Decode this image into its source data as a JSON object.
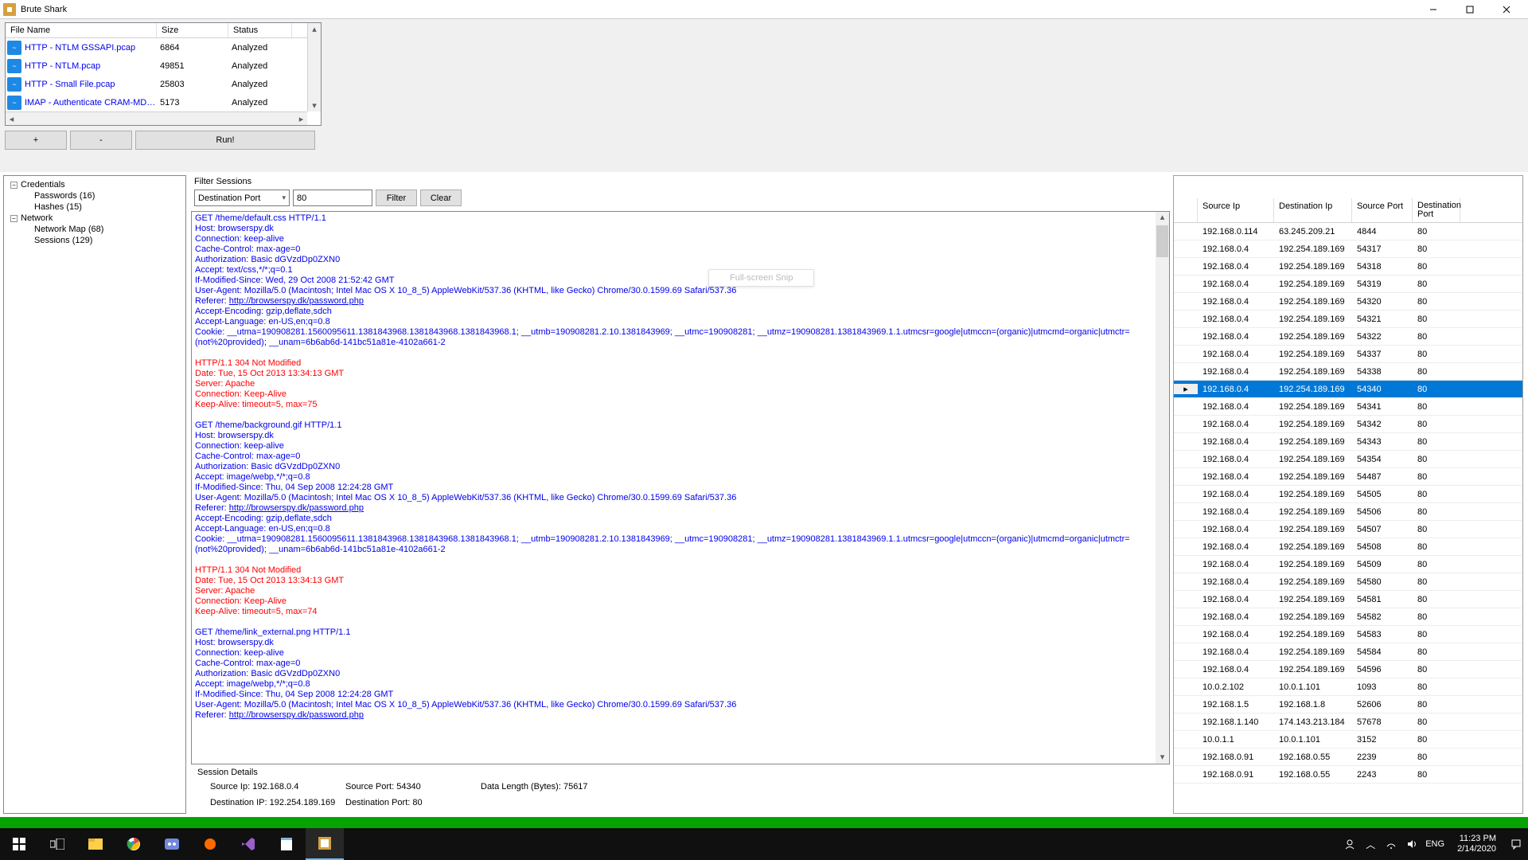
{
  "window": {
    "title": "Brute Shark"
  },
  "file_table": {
    "headers": {
      "name": "File Name",
      "size": "Size",
      "status": "Status"
    },
    "rows": [
      {
        "name": "HTTP - NTLM GSSAPI.pcap",
        "size": "6864",
        "status": "Analyzed"
      },
      {
        "name": "HTTP - NTLM.pcap",
        "size": "49851",
        "status": "Analyzed"
      },
      {
        "name": "HTTP - Small File.pcap",
        "size": "25803",
        "status": "Analyzed"
      },
      {
        "name": "IMAP - Authenticate CRAM-MD5...",
        "size": "5173",
        "status": "Analyzed"
      }
    ]
  },
  "buttons": {
    "plus": "+",
    "minus": "-",
    "run": "Run!"
  },
  "tree": {
    "credentials": "Credentials",
    "passwords": "Passwords (16)",
    "hashes": "Hashes (15)",
    "network": "Network",
    "map": "Network Map (68)",
    "sessions": "Sessions (129)"
  },
  "filter": {
    "label": "Filter Sessions",
    "field": "Destination Port",
    "value": "80",
    "filter_btn": "Filter",
    "clear_btn": "Clear"
  },
  "http": {
    "req1": [
      "GET /theme/default.css HTTP/1.1",
      "Host: browserspy.dk",
      "Connection: keep-alive",
      "Cache-Control: max-age=0",
      "Authorization: Basic dGVzdDp0ZXN0",
      "Accept: text/css,*/*;q=0.1",
      "If-Modified-Since: Wed, 29 Oct 2008 21:52:42 GMT",
      "User-Agent: Mozilla/5.0 (Macintosh; Intel Mac OS X 10_8_5) AppleWebKit/537.36 (KHTML, like Gecko) Chrome/30.0.1599.69 Safari/537.36",
      "Accept-Encoding: gzip,deflate,sdch",
      "Accept-Language: en-US,en;q=0.8",
      "Cookie: __utma=190908281.1560095611.1381843968.1381843968.1381843968.1; __utmb=190908281.2.10.1381843969; __utmc=190908281; __utmz=190908281.1381843969.1.1.utmcsr=google|utmccn=(organic)|utmcmd=organic|utmctr=(not%20provided); __unam=6b6ab6d-141bc51a81e-4102a661-2"
    ],
    "referer_label": "Referer: ",
    "referer_url": "http://browserspy.dk/password.php",
    "resp1": [
      "HTTP/1.1 304 Not Modified",
      "Date: Tue, 15 Oct 2013 13:34:13 GMT",
      "Server: Apache",
      "Connection: Keep-Alive",
      "Keep-Alive: timeout=5, max=75"
    ],
    "req2": [
      "GET /theme/background.gif HTTP/1.1",
      "Host: browserspy.dk",
      "Connection: keep-alive",
      "Cache-Control: max-age=0",
      "Authorization: Basic dGVzdDp0ZXN0",
      "Accept: image/webp,*/*;q=0.8",
      "If-Modified-Since: Thu, 04 Sep 2008 12:24:28 GMT",
      "User-Agent: Mozilla/5.0 (Macintosh; Intel Mac OS X 10_8_5) AppleWebKit/537.36 (KHTML, like Gecko) Chrome/30.0.1599.69 Safari/537.36",
      "Accept-Encoding: gzip,deflate,sdch",
      "Accept-Language: en-US,en;q=0.8",
      "Cookie: __utma=190908281.1560095611.1381843968.1381843968.1381843968.1; __utmb=190908281.2.10.1381843969; __utmc=190908281; __utmz=190908281.1381843969.1.1.utmcsr=google|utmccn=(organic)|utmcmd=organic|utmctr=(not%20provided); __unam=6b6ab6d-141bc51a81e-4102a661-2"
    ],
    "resp2": [
      "HTTP/1.1 304 Not Modified",
      "Date: Tue, 15 Oct 2013 13:34:13 GMT",
      "Server: Apache",
      "Connection: Keep-Alive",
      "Keep-Alive: timeout=5, max=74"
    ],
    "req3": [
      "GET /theme/link_external.png HTTP/1.1",
      "Host: browserspy.dk",
      "Connection: keep-alive",
      "Cache-Control: max-age=0",
      "Authorization: Basic dGVzdDp0ZXN0",
      "Accept: image/webp,*/*;q=0.8",
      "If-Modified-Since: Thu, 04 Sep 2008 12:24:28 GMT",
      "User-Agent: Mozilla/5.0 (Macintosh; Intel Mac OS X 10_8_5) AppleWebKit/537.36 (KHTML, like Gecko) Chrome/30.0.1599.69 Safari/537.36"
    ]
  },
  "details": {
    "label": "Session Details",
    "sip_l": "Source Ip:",
    "sip_v": "192.168.0.4",
    "sp_l": "Source Port:",
    "sp_v": "54340",
    "dl_l": "Data Length (Bytes):",
    "dl_v": "75617",
    "dip_l": "Destination IP:",
    "dip_v": "192.254.189.169",
    "dp_l": "Destination Port:",
    "dp_v": "80"
  },
  "sessions": {
    "headers": {
      "sip": "Source Ip",
      "dip": "Destination Ip",
      "sp": "Source Port",
      "dp": "Destination Port"
    },
    "rows": [
      {
        "sip": "192.168.0.114",
        "dip": "63.245.209.21",
        "sp": "4844",
        "dp": "80",
        "sel": false
      },
      {
        "sip": "192.168.0.4",
        "dip": "192.254.189.169",
        "sp": "54317",
        "dp": "80",
        "sel": false
      },
      {
        "sip": "192.168.0.4",
        "dip": "192.254.189.169",
        "sp": "54318",
        "dp": "80",
        "sel": false
      },
      {
        "sip": "192.168.0.4",
        "dip": "192.254.189.169",
        "sp": "54319",
        "dp": "80",
        "sel": false
      },
      {
        "sip": "192.168.0.4",
        "dip": "192.254.189.169",
        "sp": "54320",
        "dp": "80",
        "sel": false
      },
      {
        "sip": "192.168.0.4",
        "dip": "192.254.189.169",
        "sp": "54321",
        "dp": "80",
        "sel": false
      },
      {
        "sip": "192.168.0.4",
        "dip": "192.254.189.169",
        "sp": "54322",
        "dp": "80",
        "sel": false
      },
      {
        "sip": "192.168.0.4",
        "dip": "192.254.189.169",
        "sp": "54337",
        "dp": "80",
        "sel": false
      },
      {
        "sip": "192.168.0.4",
        "dip": "192.254.189.169",
        "sp": "54338",
        "dp": "80",
        "sel": false
      },
      {
        "sip": "192.168.0.4",
        "dip": "192.254.189.169",
        "sp": "54340",
        "dp": "80",
        "sel": true
      },
      {
        "sip": "192.168.0.4",
        "dip": "192.254.189.169",
        "sp": "54341",
        "dp": "80",
        "sel": false
      },
      {
        "sip": "192.168.0.4",
        "dip": "192.254.189.169",
        "sp": "54342",
        "dp": "80",
        "sel": false
      },
      {
        "sip": "192.168.0.4",
        "dip": "192.254.189.169",
        "sp": "54343",
        "dp": "80",
        "sel": false
      },
      {
        "sip": "192.168.0.4",
        "dip": "192.254.189.169",
        "sp": "54354",
        "dp": "80",
        "sel": false
      },
      {
        "sip": "192.168.0.4",
        "dip": "192.254.189.169",
        "sp": "54487",
        "dp": "80",
        "sel": false
      },
      {
        "sip": "192.168.0.4",
        "dip": "192.254.189.169",
        "sp": "54505",
        "dp": "80",
        "sel": false
      },
      {
        "sip": "192.168.0.4",
        "dip": "192.254.189.169",
        "sp": "54506",
        "dp": "80",
        "sel": false
      },
      {
        "sip": "192.168.0.4",
        "dip": "192.254.189.169",
        "sp": "54507",
        "dp": "80",
        "sel": false
      },
      {
        "sip": "192.168.0.4",
        "dip": "192.254.189.169",
        "sp": "54508",
        "dp": "80",
        "sel": false
      },
      {
        "sip": "192.168.0.4",
        "dip": "192.254.189.169",
        "sp": "54509",
        "dp": "80",
        "sel": false
      },
      {
        "sip": "192.168.0.4",
        "dip": "192.254.189.169",
        "sp": "54580",
        "dp": "80",
        "sel": false
      },
      {
        "sip": "192.168.0.4",
        "dip": "192.254.189.169",
        "sp": "54581",
        "dp": "80",
        "sel": false
      },
      {
        "sip": "192.168.0.4",
        "dip": "192.254.189.169",
        "sp": "54582",
        "dp": "80",
        "sel": false
      },
      {
        "sip": "192.168.0.4",
        "dip": "192.254.189.169",
        "sp": "54583",
        "dp": "80",
        "sel": false
      },
      {
        "sip": "192.168.0.4",
        "dip": "192.254.189.169",
        "sp": "54584",
        "dp": "80",
        "sel": false
      },
      {
        "sip": "192.168.0.4",
        "dip": "192.254.189.169",
        "sp": "54596",
        "dp": "80",
        "sel": false
      },
      {
        "sip": "10.0.2.102",
        "dip": "10.0.1.101",
        "sp": "1093",
        "dp": "80",
        "sel": false
      },
      {
        "sip": "192.168.1.5",
        "dip": "192.168.1.8",
        "sp": "52606",
        "dp": "80",
        "sel": false
      },
      {
        "sip": "192.168.1.140",
        "dip": "174.143.213.184",
        "sp": "57678",
        "dp": "80",
        "sel": false
      },
      {
        "sip": "10.0.1.1",
        "dip": "10.0.1.101",
        "sp": "3152",
        "dp": "80",
        "sel": false
      },
      {
        "sip": "192.168.0.91",
        "dip": "192.168.0.55",
        "sp": "2239",
        "dp": "80",
        "sel": false
      },
      {
        "sip": "192.168.0.91",
        "dip": "192.168.0.55",
        "sp": "2243",
        "dp": "80",
        "sel": false
      }
    ]
  },
  "snip": "Full-screen Snip",
  "taskbar": {
    "lang": "ENG",
    "time": "11:23 PM",
    "date": "2/14/2020"
  }
}
